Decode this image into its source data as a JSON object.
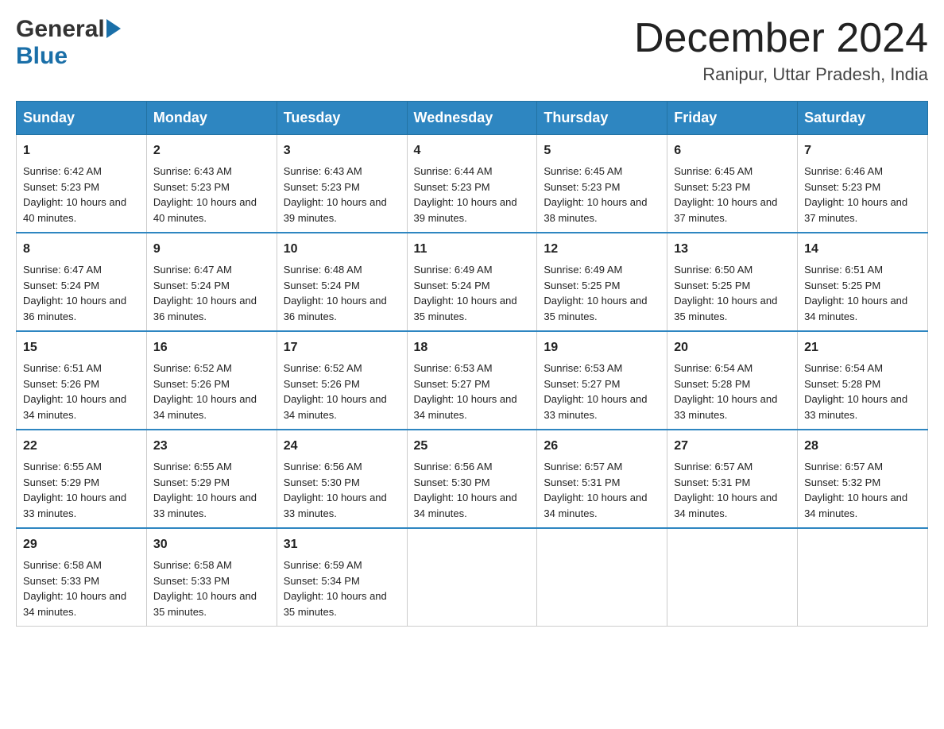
{
  "header": {
    "logo_general": "General",
    "logo_blue": "Blue",
    "month_title": "December 2024",
    "location": "Ranipur, Uttar Pradesh, India"
  },
  "days": {
    "headers": [
      "Sunday",
      "Monday",
      "Tuesday",
      "Wednesday",
      "Thursday",
      "Friday",
      "Saturday"
    ]
  },
  "weeks": [
    [
      {
        "num": "1",
        "sunrise": "Sunrise: 6:42 AM",
        "sunset": "Sunset: 5:23 PM",
        "daylight": "Daylight: 10 hours and 40 minutes."
      },
      {
        "num": "2",
        "sunrise": "Sunrise: 6:43 AM",
        "sunset": "Sunset: 5:23 PM",
        "daylight": "Daylight: 10 hours and 40 minutes."
      },
      {
        "num": "3",
        "sunrise": "Sunrise: 6:43 AM",
        "sunset": "Sunset: 5:23 PM",
        "daylight": "Daylight: 10 hours and 39 minutes."
      },
      {
        "num": "4",
        "sunrise": "Sunrise: 6:44 AM",
        "sunset": "Sunset: 5:23 PM",
        "daylight": "Daylight: 10 hours and 39 minutes."
      },
      {
        "num": "5",
        "sunrise": "Sunrise: 6:45 AM",
        "sunset": "Sunset: 5:23 PM",
        "daylight": "Daylight: 10 hours and 38 minutes."
      },
      {
        "num": "6",
        "sunrise": "Sunrise: 6:45 AM",
        "sunset": "Sunset: 5:23 PM",
        "daylight": "Daylight: 10 hours and 37 minutes."
      },
      {
        "num": "7",
        "sunrise": "Sunrise: 6:46 AM",
        "sunset": "Sunset: 5:23 PM",
        "daylight": "Daylight: 10 hours and 37 minutes."
      }
    ],
    [
      {
        "num": "8",
        "sunrise": "Sunrise: 6:47 AM",
        "sunset": "Sunset: 5:24 PM",
        "daylight": "Daylight: 10 hours and 36 minutes."
      },
      {
        "num": "9",
        "sunrise": "Sunrise: 6:47 AM",
        "sunset": "Sunset: 5:24 PM",
        "daylight": "Daylight: 10 hours and 36 minutes."
      },
      {
        "num": "10",
        "sunrise": "Sunrise: 6:48 AM",
        "sunset": "Sunset: 5:24 PM",
        "daylight": "Daylight: 10 hours and 36 minutes."
      },
      {
        "num": "11",
        "sunrise": "Sunrise: 6:49 AM",
        "sunset": "Sunset: 5:24 PM",
        "daylight": "Daylight: 10 hours and 35 minutes."
      },
      {
        "num": "12",
        "sunrise": "Sunrise: 6:49 AM",
        "sunset": "Sunset: 5:25 PM",
        "daylight": "Daylight: 10 hours and 35 minutes."
      },
      {
        "num": "13",
        "sunrise": "Sunrise: 6:50 AM",
        "sunset": "Sunset: 5:25 PM",
        "daylight": "Daylight: 10 hours and 35 minutes."
      },
      {
        "num": "14",
        "sunrise": "Sunrise: 6:51 AM",
        "sunset": "Sunset: 5:25 PM",
        "daylight": "Daylight: 10 hours and 34 minutes."
      }
    ],
    [
      {
        "num": "15",
        "sunrise": "Sunrise: 6:51 AM",
        "sunset": "Sunset: 5:26 PM",
        "daylight": "Daylight: 10 hours and 34 minutes."
      },
      {
        "num": "16",
        "sunrise": "Sunrise: 6:52 AM",
        "sunset": "Sunset: 5:26 PM",
        "daylight": "Daylight: 10 hours and 34 minutes."
      },
      {
        "num": "17",
        "sunrise": "Sunrise: 6:52 AM",
        "sunset": "Sunset: 5:26 PM",
        "daylight": "Daylight: 10 hours and 34 minutes."
      },
      {
        "num": "18",
        "sunrise": "Sunrise: 6:53 AM",
        "sunset": "Sunset: 5:27 PM",
        "daylight": "Daylight: 10 hours and 34 minutes."
      },
      {
        "num": "19",
        "sunrise": "Sunrise: 6:53 AM",
        "sunset": "Sunset: 5:27 PM",
        "daylight": "Daylight: 10 hours and 33 minutes."
      },
      {
        "num": "20",
        "sunrise": "Sunrise: 6:54 AM",
        "sunset": "Sunset: 5:28 PM",
        "daylight": "Daylight: 10 hours and 33 minutes."
      },
      {
        "num": "21",
        "sunrise": "Sunrise: 6:54 AM",
        "sunset": "Sunset: 5:28 PM",
        "daylight": "Daylight: 10 hours and 33 minutes."
      }
    ],
    [
      {
        "num": "22",
        "sunrise": "Sunrise: 6:55 AM",
        "sunset": "Sunset: 5:29 PM",
        "daylight": "Daylight: 10 hours and 33 minutes."
      },
      {
        "num": "23",
        "sunrise": "Sunrise: 6:55 AM",
        "sunset": "Sunset: 5:29 PM",
        "daylight": "Daylight: 10 hours and 33 minutes."
      },
      {
        "num": "24",
        "sunrise": "Sunrise: 6:56 AM",
        "sunset": "Sunset: 5:30 PM",
        "daylight": "Daylight: 10 hours and 33 minutes."
      },
      {
        "num": "25",
        "sunrise": "Sunrise: 6:56 AM",
        "sunset": "Sunset: 5:30 PM",
        "daylight": "Daylight: 10 hours and 34 minutes."
      },
      {
        "num": "26",
        "sunrise": "Sunrise: 6:57 AM",
        "sunset": "Sunset: 5:31 PM",
        "daylight": "Daylight: 10 hours and 34 minutes."
      },
      {
        "num": "27",
        "sunrise": "Sunrise: 6:57 AM",
        "sunset": "Sunset: 5:31 PM",
        "daylight": "Daylight: 10 hours and 34 minutes."
      },
      {
        "num": "28",
        "sunrise": "Sunrise: 6:57 AM",
        "sunset": "Sunset: 5:32 PM",
        "daylight": "Daylight: 10 hours and 34 minutes."
      }
    ],
    [
      {
        "num": "29",
        "sunrise": "Sunrise: 6:58 AM",
        "sunset": "Sunset: 5:33 PM",
        "daylight": "Daylight: 10 hours and 34 minutes."
      },
      {
        "num": "30",
        "sunrise": "Sunrise: 6:58 AM",
        "sunset": "Sunset: 5:33 PM",
        "daylight": "Daylight: 10 hours and 35 minutes."
      },
      {
        "num": "31",
        "sunrise": "Sunrise: 6:59 AM",
        "sunset": "Sunset: 5:34 PM",
        "daylight": "Daylight: 10 hours and 35 minutes."
      },
      null,
      null,
      null,
      null
    ]
  ]
}
